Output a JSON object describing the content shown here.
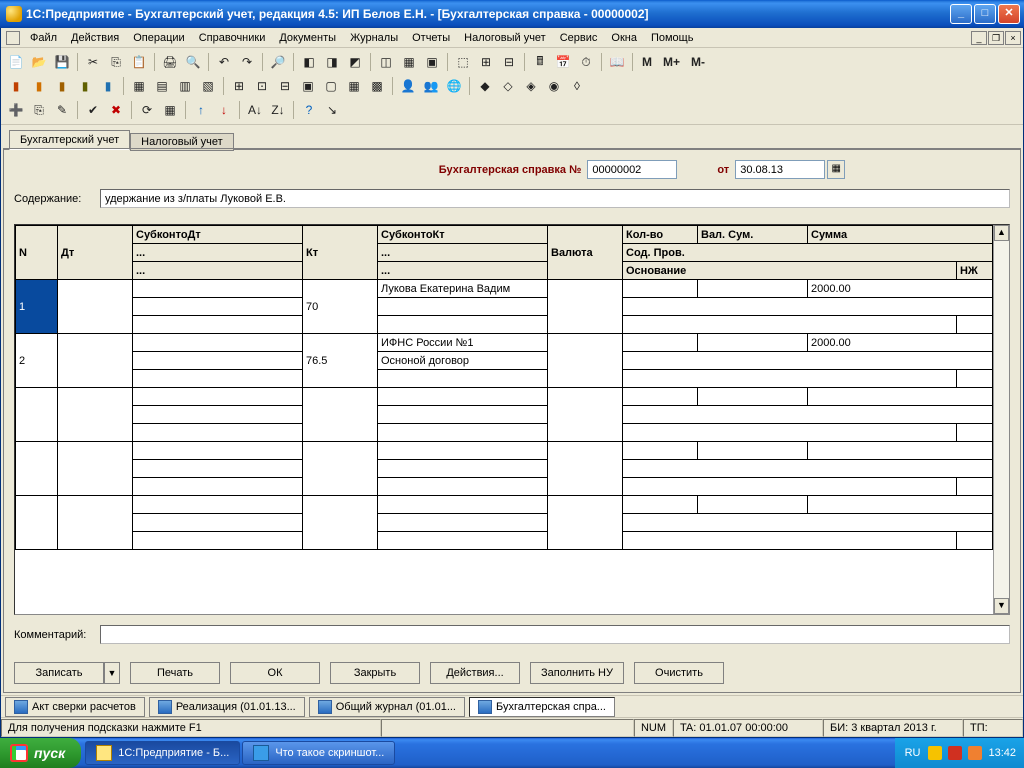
{
  "window": {
    "title": "1С:Предприятие - Бухгалтерский учет, редакция 4.5: ИП Белов Е.Н. - [Бухгалтерская справка - 00000002]"
  },
  "menu": {
    "file": "Файл",
    "actions": "Действия",
    "operations": "Операции",
    "refs": "Справочники",
    "docs": "Документы",
    "journals": "Журналы",
    "reports": "Отчеты",
    "tax": "Налоговый учет",
    "service": "Сервис",
    "windows": "Окна",
    "help": "Помощь"
  },
  "toolbar_text": {
    "m_bold": "М",
    "m_plus": "М+",
    "m_minus": "М-"
  },
  "tabs": {
    "accounting": "Бухгалтерский учет",
    "tax": "Налоговый учет"
  },
  "doc": {
    "title_label": "Бухгалтерская справка №",
    "number": "00000002",
    "from_label": "от",
    "date": "30.08.13",
    "content_label": "Содержание:",
    "content_value": "удержание из з/платы Луковой Е.В.",
    "comment_label": "Комментарий:",
    "comment_value": ""
  },
  "grid": {
    "headers": {
      "n": "N",
      "dt": "Дт",
      "subdt": "СубконтоДт",
      "kt": "Кт",
      "subkt": "СубконтоКт",
      "currency": "Валюта",
      "qty": "Кол-во",
      "valsum": "Вал. Сум.",
      "sum": "Сумма",
      "sodprov": "Сод. Пров.",
      "osnovanie": "Основание",
      "nzh": "НЖ",
      "dots": "..."
    },
    "rows": [
      {
        "n": "1",
        "dt": "",
        "subdt1": "",
        "subdt2": "",
        "subdt3": "",
        "kt": "70",
        "subkt1": "Лукова Екатерина Вадим",
        "subkt2": "",
        "subkt3": "",
        "currency": "",
        "qty": "",
        "valsum": "",
        "sum": "2000.00",
        "sodprov": "",
        "osnovanie": "",
        "nzh": ""
      },
      {
        "n": "2",
        "dt": "",
        "subdt1": "",
        "subdt2": "",
        "subdt3": "",
        "kt": "76.5",
        "subkt1": "ИФНС России №1",
        "subkt2": "Осноной договор",
        "subkt3": "",
        "currency": "",
        "qty": "",
        "valsum": "",
        "sum": "2000.00",
        "sodprov": "",
        "osnovanie": "",
        "nzh": ""
      }
    ]
  },
  "buttons": {
    "write": "Записать",
    "print": "Печать",
    "ok": "ОК",
    "close": "Закрыть",
    "actions": "Действия...",
    "fill_tax": "Заполнить НУ",
    "clear": "Очистить"
  },
  "window_tabs": [
    {
      "label": "Акт сверки расчетов"
    },
    {
      "label": "Реализация (01.01.13..."
    },
    {
      "label": "Общий журнал (01.01..."
    },
    {
      "label": "Бухгалтерская спра..."
    }
  ],
  "status": {
    "hint": "Для получения подсказки нажмите F1",
    "num": "NUM",
    "ta": "TA: 01.01.07  00:00:00",
    "bi": "БИ: 3 квартал 2013 г.",
    "tp": "ТП:"
  },
  "taskbar": {
    "start": "пуск",
    "tasks": [
      {
        "label": "1С:Предприятие - Б..."
      },
      {
        "label": "Что такое скриншот..."
      }
    ],
    "lang": "RU",
    "clock": "13:42"
  }
}
